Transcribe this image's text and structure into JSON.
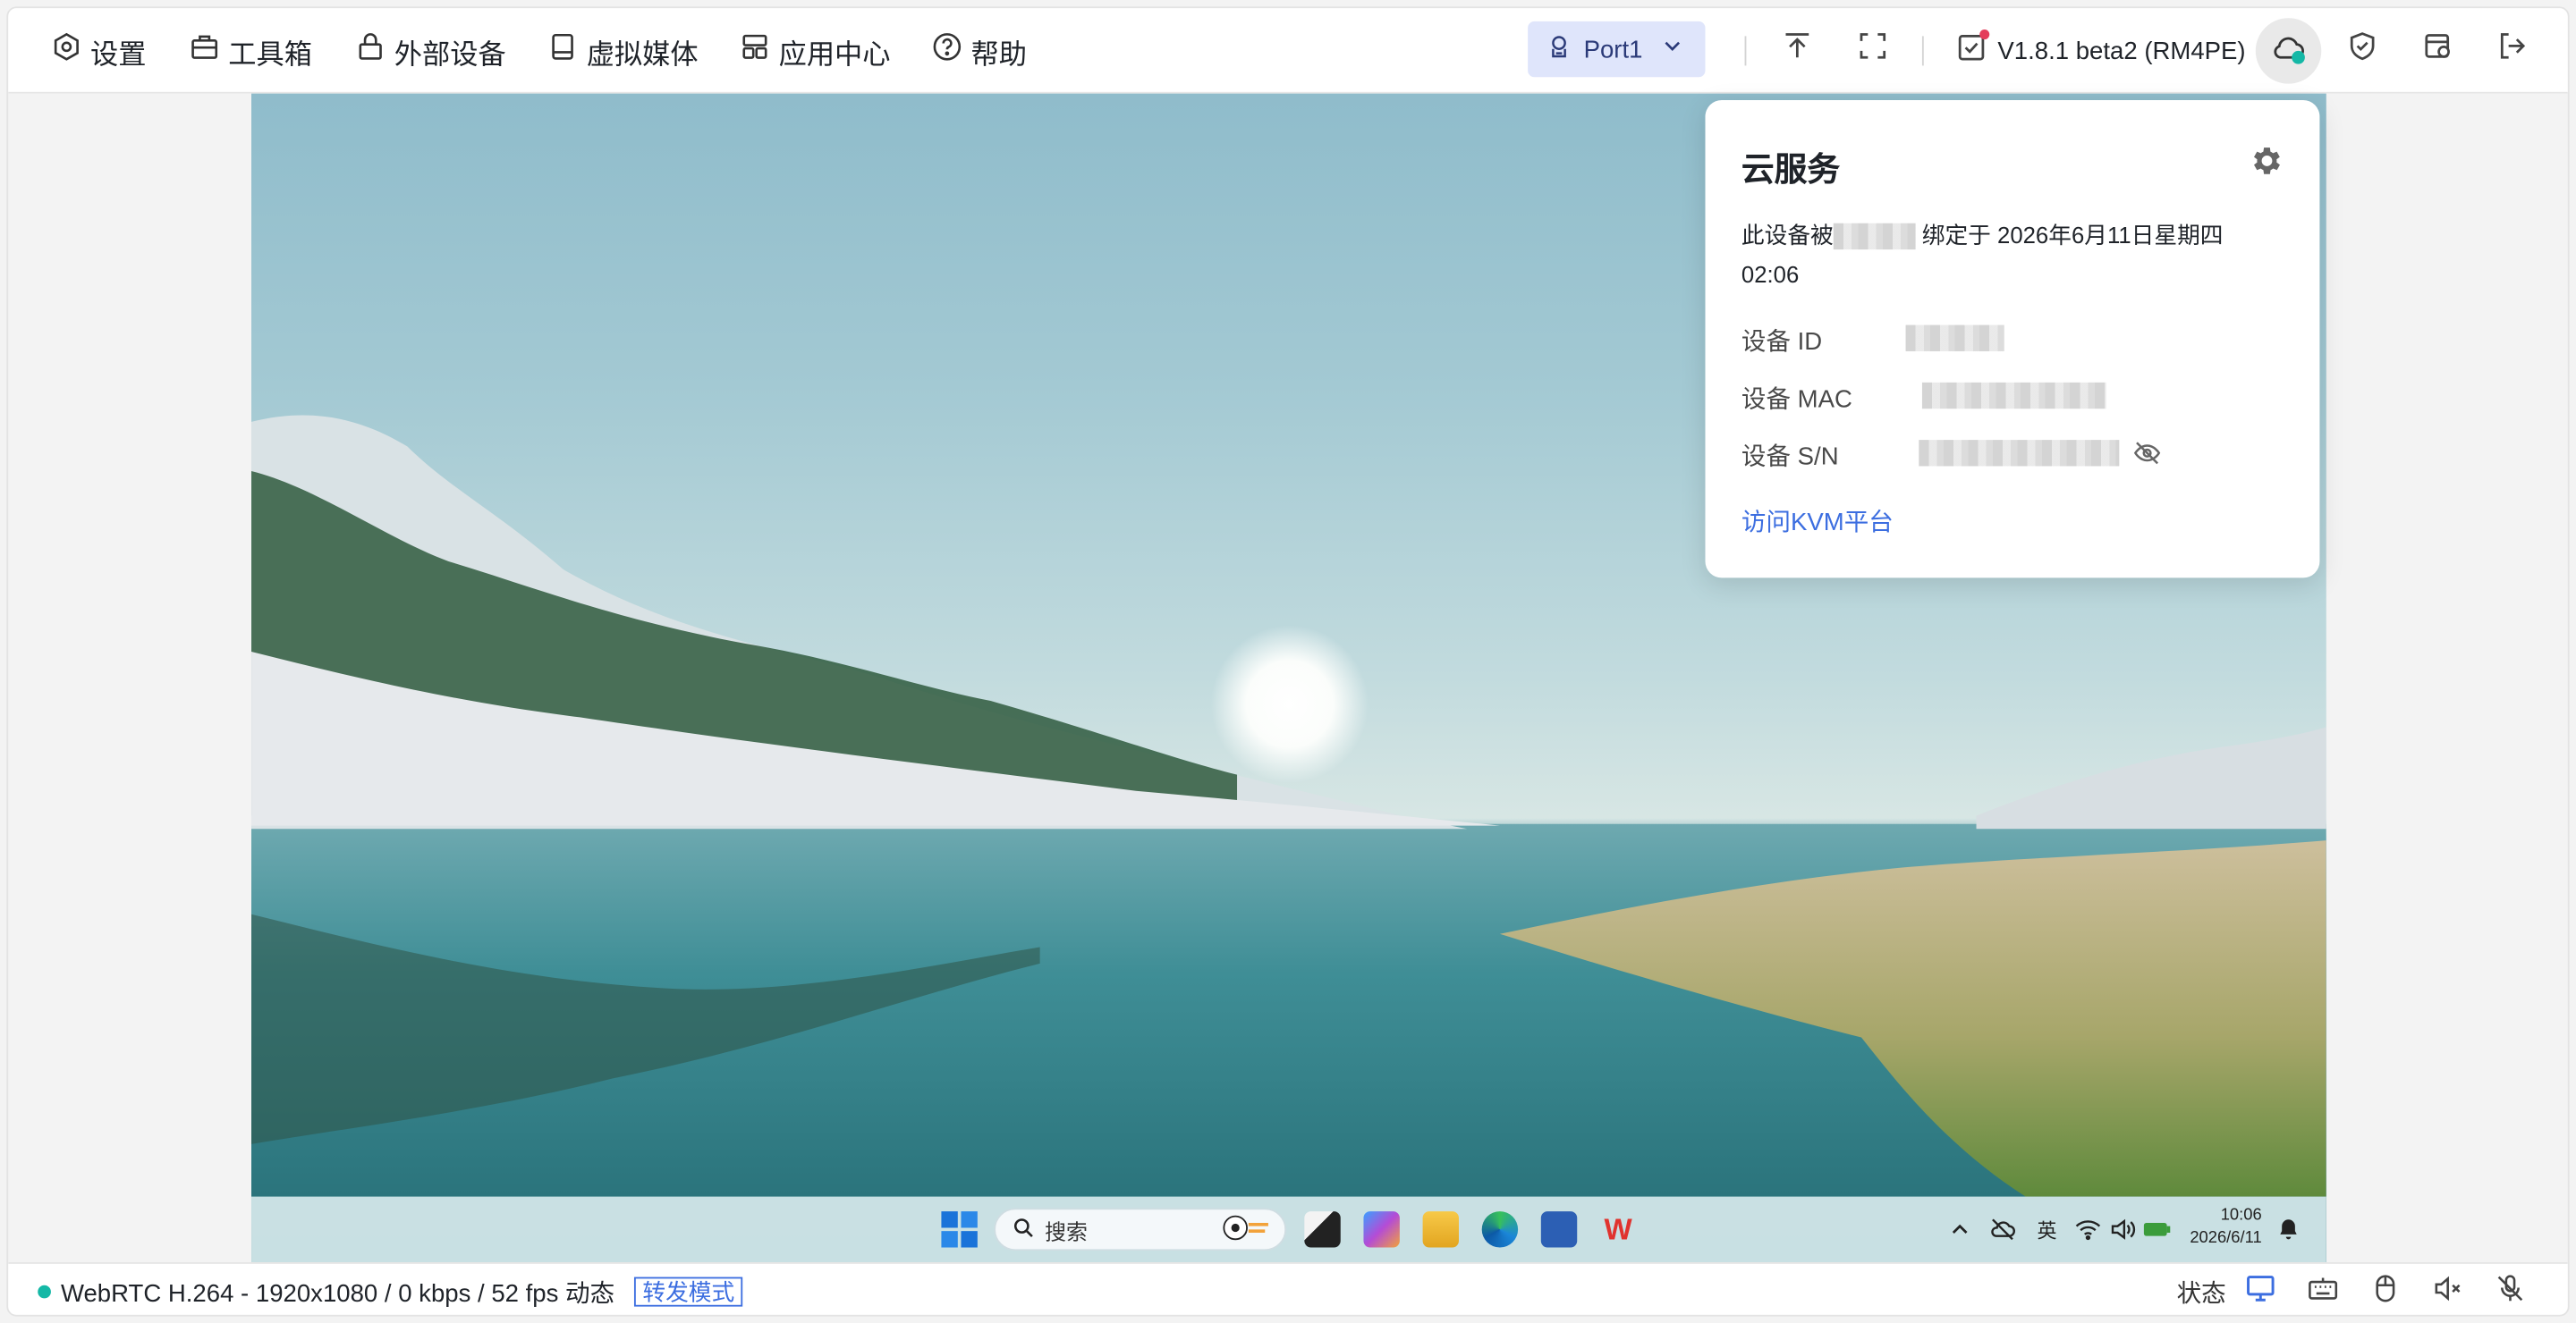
{
  "menu": [
    {
      "label": "设置",
      "icon": "settings-hex-icon"
    },
    {
      "label": "工具箱",
      "icon": "toolbox-icon"
    },
    {
      "label": "外部设备",
      "icon": "lock-device-icon"
    },
    {
      "label": "虚拟媒体",
      "icon": "drive-icon"
    },
    {
      "label": "应用中心",
      "icon": "grid-apps-icon"
    },
    {
      "label": "帮助",
      "icon": "help-circle-icon"
    }
  ],
  "port": {
    "label": "Port1",
    "icon": "port-icon"
  },
  "version": {
    "label": "V1.8.1 beta2 (RM4PE)"
  },
  "colors": {
    "accent": "#3c6ee0",
    "status_ok": "#14b8a6",
    "alert": "#e43d5b"
  },
  "cloud_popup": {
    "title": "云服务",
    "bind_prefix": "此设备被",
    "bind_suffix": "绑定于 2026年6月11日星期四 02:06",
    "rows": [
      {
        "label": "设备 ID"
      },
      {
        "label": "设备 MAC"
      },
      {
        "label": "设备 S/N"
      }
    ],
    "link": "访问KVM平台"
  },
  "taskbar": {
    "search_placeholder": "搜索",
    "ime": "英",
    "time": "10:06",
    "date": "2026/6/11"
  },
  "status": {
    "stream": "WebRTC H.264 - 1920x1080 / 0 kbps / 52 fps 动态",
    "mode_tag": "转发模式",
    "state_label": "状态"
  }
}
